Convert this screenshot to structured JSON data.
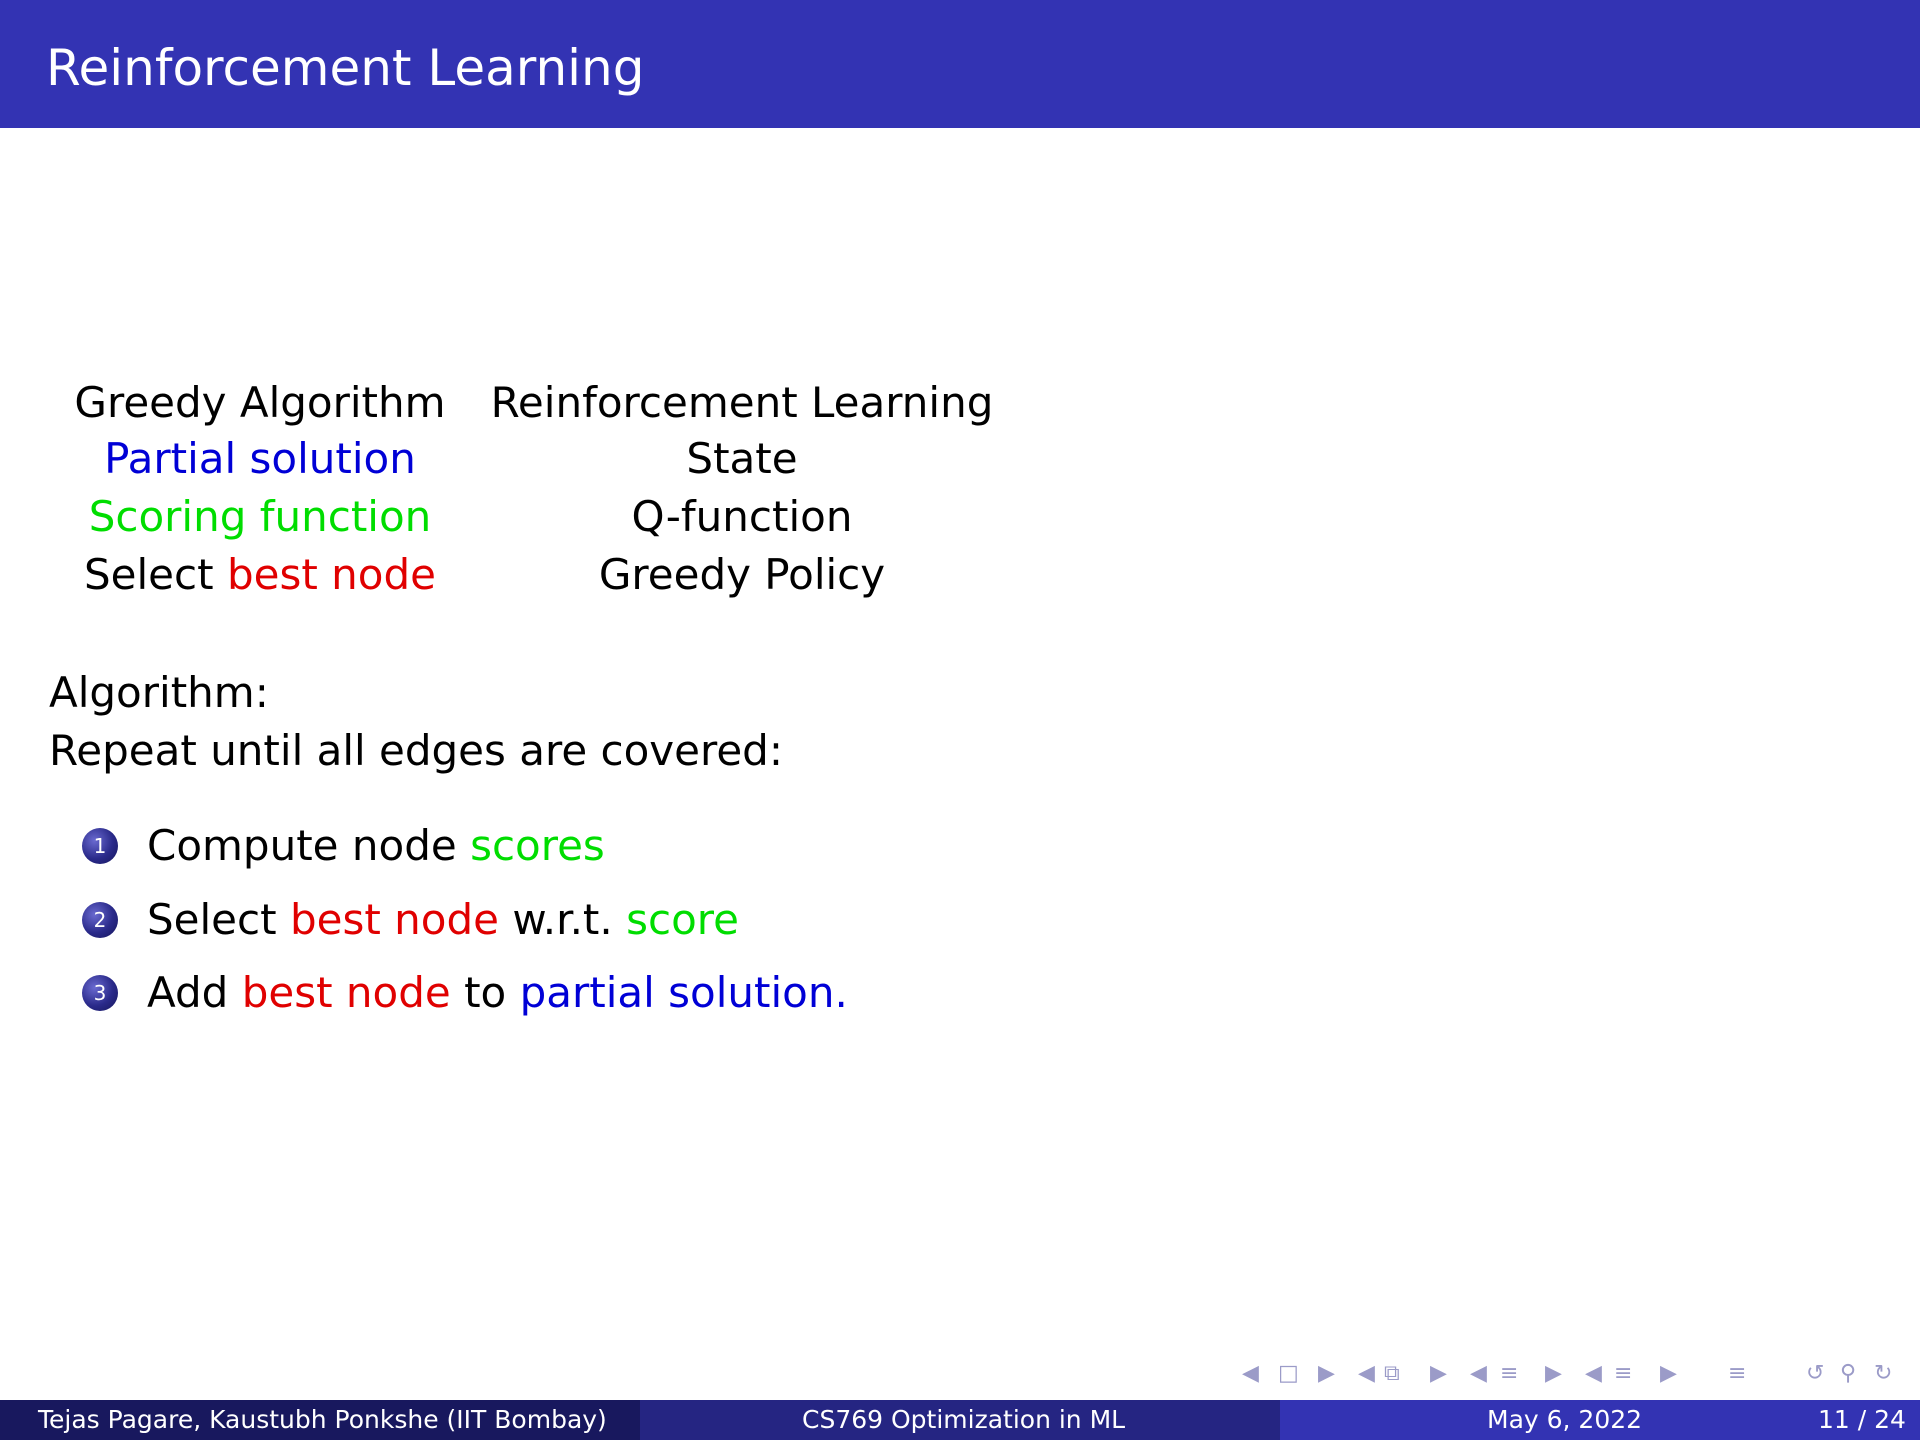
{
  "slide": {
    "title": "Reinforcement Learning"
  },
  "comparison": {
    "left_header": "Greedy Algorithm",
    "right_header": "Reinforcement Learning",
    "rows": [
      {
        "left": "Partial solution",
        "right": "State"
      },
      {
        "left": "Scoring function",
        "right": "Q-function"
      },
      {
        "left_prefix": "Select",
        "left_highlight": "best node",
        "right": "Greedy Policy"
      }
    ]
  },
  "algorithm": {
    "heading": "Algorithm:",
    "intro": "Repeat until all edges are covered:",
    "steps": [
      {
        "num": "1",
        "a": "Compute node",
        "b": "scores"
      },
      {
        "num": "2",
        "a": "Select",
        "b": "best node",
        "c": "w.r.t.",
        "d": "score"
      },
      {
        "num": "3",
        "a": "Add",
        "b": "best node",
        "c": "to",
        "d": "partial solution",
        "e": "."
      }
    ]
  },
  "colors": {
    "title_bar": "#3333b3",
    "blue_text": "#0000d6",
    "green_text": "#00dd00",
    "red_text": "#e00000"
  },
  "footer": {
    "authors": "Tejas Pagare, Kaustubh Ponkshe  (IIT Bombay)",
    "course": "CS769 Optimization in ML",
    "date": "May 6, 2022",
    "page": "11 / 24"
  },
  "navigation": {
    "icons": [
      "nav-prev-arrow",
      "frame-icon",
      "nav-next-arrow",
      "nav-prev-arrow",
      "subsection-icon",
      "nav-next-arrow",
      "nav-prev-arrow",
      "section-icon",
      "nav-next-arrow",
      "nav-prev-arrow",
      "section-icon",
      "nav-next-arrow",
      "align-icon",
      "undo-icon",
      "search-icon",
      "redo-icon"
    ]
  }
}
